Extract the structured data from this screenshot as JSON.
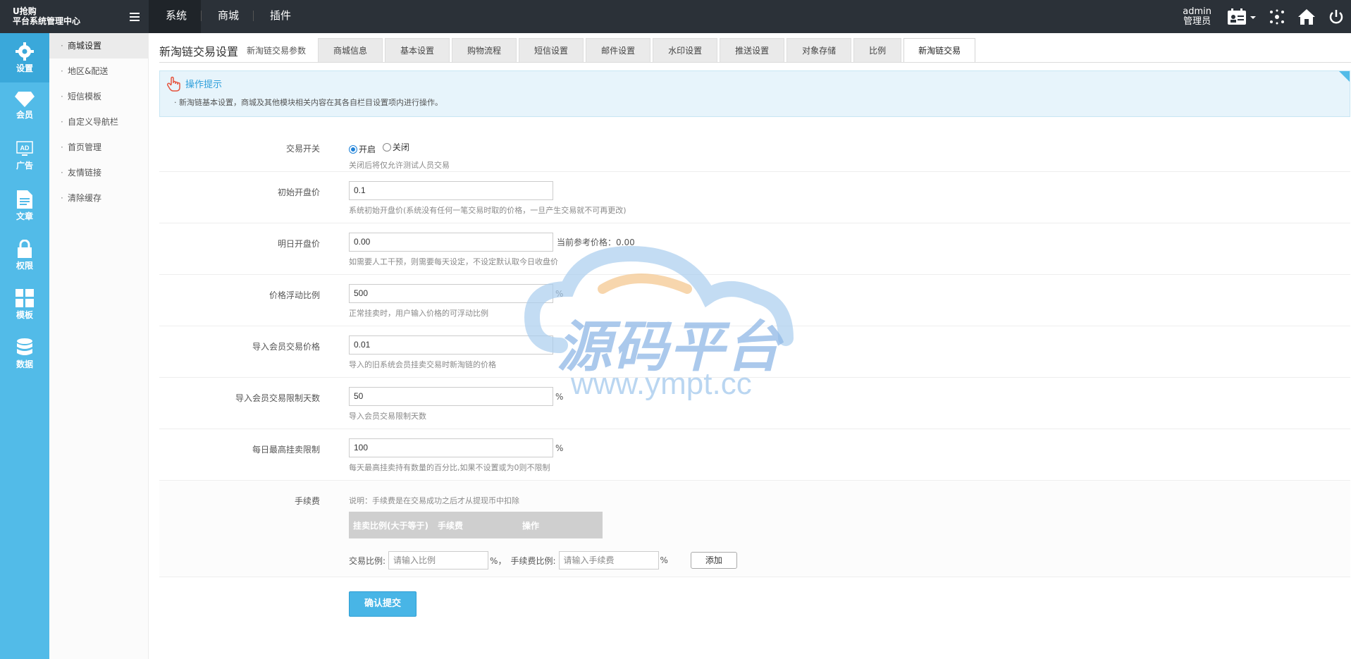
{
  "brand": {
    "line1": "U抢购",
    "line2": "平台系统管理中心"
  },
  "topnav": [
    {
      "label": "系统"
    },
    {
      "label": "商城"
    },
    {
      "label": "插件"
    }
  ],
  "user": {
    "name": "admin",
    "role": "管理员"
  },
  "iconbar": [
    {
      "label": "设置",
      "icon": "gear-icon"
    },
    {
      "label": "会员",
      "icon": "diamond-icon"
    },
    {
      "label": "广告",
      "icon": "ad-icon"
    },
    {
      "label": "文章",
      "icon": "document-icon"
    },
    {
      "label": "权限",
      "icon": "lock-icon"
    },
    {
      "label": "模板",
      "icon": "grid-icon"
    },
    {
      "label": "数据",
      "icon": "database-icon"
    }
  ],
  "submenu": [
    {
      "label": "商城设置"
    },
    {
      "label": "地区&配送"
    },
    {
      "label": "短信模板"
    },
    {
      "label": "自定义导航栏"
    },
    {
      "label": "首页管理"
    },
    {
      "label": "友情链接"
    },
    {
      "label": "清除缓存"
    }
  ],
  "page": {
    "title": "新淘链交易设置",
    "subtitle": "新淘链交易参数"
  },
  "tabs": [
    {
      "label": "商城信息"
    },
    {
      "label": "基本设置"
    },
    {
      "label": "购物流程"
    },
    {
      "label": "短信设置"
    },
    {
      "label": "邮件设置"
    },
    {
      "label": "水印设置"
    },
    {
      "label": "推送设置"
    },
    {
      "label": "对象存储"
    },
    {
      "label": "比例"
    },
    {
      "label": "新淘链交易"
    }
  ],
  "tip": {
    "title": "操作提示",
    "text": "新淘链基本设置，商城及其他模块相关内容在其各自栏目设置项内进行操作。"
  },
  "form": {
    "switch": {
      "label": "交易开关",
      "on": "开启",
      "off": "关闭",
      "hint": "关闭后将仅允许测试人员交易"
    },
    "initial_price": {
      "label": "初始开盘价",
      "value": "0.1",
      "hint": "系统初始开盘价(系统没有任何一笔交易时取的价格，一旦产生交易就不可再更改)"
    },
    "tomorrow_price": {
      "label": "明日开盘价",
      "value": "0.00",
      "ref": "当前参考价格：0.00",
      "hint": "如需要人工干预，则需要每天设定，不设定默认取今日收盘价"
    },
    "float_ratio": {
      "label": "价格浮动比例",
      "value": "500",
      "unit": "%",
      "hint": "正常挂卖时，用户输入价格的可浮动比例"
    },
    "import_price": {
      "label": "导入会员交易价格",
      "value": "0.01",
      "hint": "导入的旧系统会员挂卖交易时新淘链的价格"
    },
    "import_days": {
      "label": "导入会员交易限制天数",
      "value": "50",
      "unit": "%",
      "hint": "导入会员交易限制天数"
    },
    "daily_limit": {
      "label": "每日最高挂卖限制",
      "value": "100",
      "unit": "%",
      "hint": "每天最高挂卖持有数量的百分比,如果不设置或为0则不限制"
    },
    "fee": {
      "label": "手续费",
      "note": "说明：手续费是在交易成功之后才从提现币中扣除",
      "columns": [
        "挂卖比例(大于等于)",
        "手续费",
        "操作"
      ],
      "ratio_label": "交易比例:",
      "ratio_placeholder": "请输入比例",
      "pct1": "%，",
      "fee_label": "手续费比例:",
      "fee_placeholder": "请输入手续费",
      "pct2": "%",
      "add": "添加"
    },
    "submit": "确认提交"
  },
  "watermark": {
    "text": "源码平台",
    "url": "www.ympt.cc"
  }
}
